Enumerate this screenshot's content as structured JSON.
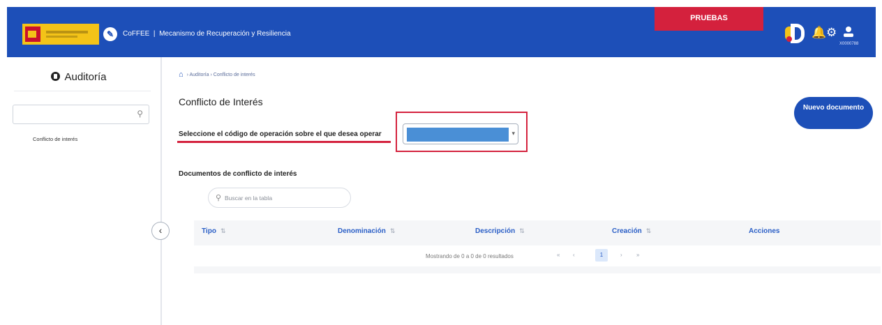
{
  "header": {
    "app_name": "CoFFEE",
    "separator": "|",
    "app_subtitle": "Mecanismo de Recuperación y Resiliencia",
    "env_badge": "PRUEBAS",
    "user_code": "X0000788",
    "icons": [
      "bell-icon",
      "gear-icon",
      "user-icon"
    ],
    "brand_color": "#1d4fb8",
    "badge_color": "#d4213d"
  },
  "sidebar": {
    "title": "Auditoría",
    "search_placeholder": "",
    "items": [
      {
        "label": "Conflicto de interés"
      }
    ],
    "collapse_label": "‹"
  },
  "breadcrumb": [
    "Auditoría",
    "Conflicto de interés"
  ],
  "main": {
    "title": "Conflicto de Interés",
    "select_label": "Seleccione el código de operación sobre el que desea operar",
    "select_value": "",
    "new_button": "Nuevo documento",
    "docs_subtitle": "Documentos de conflicto de interés",
    "table_search_placeholder": "Buscar en la tabla"
  },
  "table": {
    "columns": [
      "Tipo",
      "Denominación",
      "Descripción",
      "Creación",
      "Acciones"
    ],
    "rows": [],
    "pagination": {
      "summary": "Mostrando de 0 a 0 de 0 resultados",
      "current_page": "1",
      "first": "«",
      "prev": "‹",
      "next": "›",
      "last": "»"
    }
  }
}
